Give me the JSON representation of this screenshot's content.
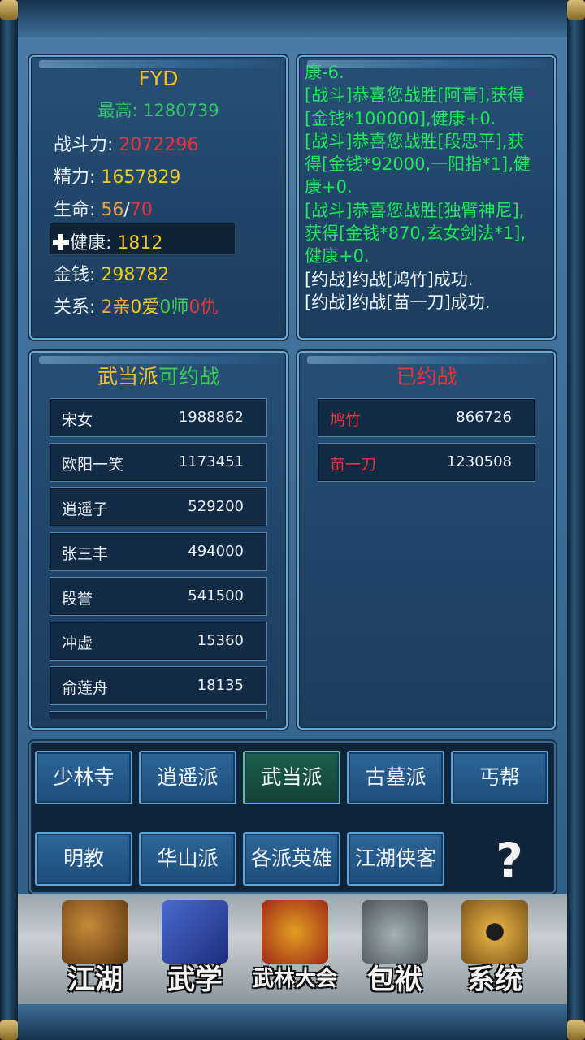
{
  "player": {
    "name": "FYD",
    "best_label": "最高:",
    "best_value": "1280739",
    "stats": [
      {
        "label": "战斗力:",
        "value": "2072296"
      },
      {
        "label": "精力:",
        "value": "1657829"
      },
      {
        "label": "生命:",
        "value_current": "56",
        "sep": "/",
        "value_max": "70"
      },
      {
        "label": "健康:",
        "value": "1812"
      },
      {
        "label": "金钱:",
        "value": "298782"
      }
    ],
    "relations": {
      "label": "关系:",
      "kin": "2亲",
      "love": "0爱",
      "master": "0师",
      "enemy": "0仇"
    }
  },
  "log_lines": [
    {
      "text": "康-6.",
      "color": "green"
    },
    {
      "text": "[战斗]恭喜您战胜[阿青],获得",
      "color": "green"
    },
    {
      "text": "[金钱*100000],健康+0.",
      "color": "green"
    },
    {
      "text": "[战斗]恭喜您战胜[段思平],获",
      "color": "green"
    },
    {
      "text": "得[金钱*92000,一阳指*1],健",
      "color": "green"
    },
    {
      "text": "康+0.",
      "color": "green"
    },
    {
      "text": "[战斗]恭喜您战胜[独臂神尼],",
      "color": "green"
    },
    {
      "text": "获得[金钱*870,玄女剑法*1],",
      "color": "green"
    },
    {
      "text": "健康+0.",
      "color": "green"
    },
    {
      "text": "[约战]约战[鸠竹]成功.",
      "color": "white"
    },
    {
      "text": "[约战]约战[苗一刀]成功.",
      "color": "white"
    }
  ],
  "left_list": {
    "title_school": "武当派",
    "title_suffix": "可约战",
    "rows": [
      {
        "name": "宋女",
        "power": "1988862"
      },
      {
        "name": "欧阳一笑",
        "power": "1173451"
      },
      {
        "name": "逍遥子",
        "power": "529200"
      },
      {
        "name": "张三丰",
        "power": "494000"
      },
      {
        "name": "段誉",
        "power": "541500"
      },
      {
        "name": "冲虚",
        "power": "15360"
      },
      {
        "name": "俞莲舟",
        "power": "18135"
      }
    ]
  },
  "right_list": {
    "title": "已约战",
    "rows": [
      {
        "name": "鸠竹",
        "power": "866726"
      },
      {
        "name": "苗一刀",
        "power": "1230508"
      }
    ]
  },
  "school_buttons": [
    "少林寺",
    "逍遥派",
    "武当派",
    "古墓派",
    "丐帮",
    "明教",
    "华山派",
    "各派英雄",
    "江湖侠客"
  ],
  "active_school": "武当派",
  "help_glyph": "?",
  "nav": [
    {
      "label": "江湖",
      "icon": "gourd-hat-icon"
    },
    {
      "label": "武学",
      "icon": "book-icon"
    },
    {
      "label": "武林大会",
      "icon": "drum-icon"
    },
    {
      "label": "包袱",
      "icon": "bag-icon"
    },
    {
      "label": "系统",
      "icon": "gear-icon"
    }
  ],
  "colors": {
    "gold": "#f5c220",
    "green": "#3dce52",
    "red": "#e8343a",
    "panel": "#274f75"
  }
}
